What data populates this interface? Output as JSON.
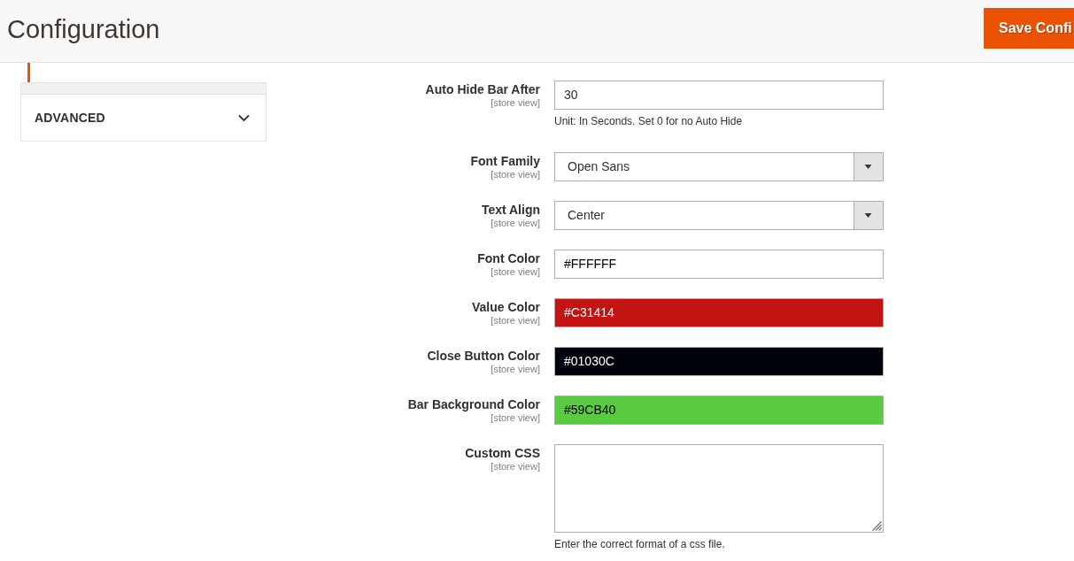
{
  "header": {
    "title": "Configuration",
    "save_button": {
      "label": "Save Confi"
    }
  },
  "sidebar": {
    "items": [
      {
        "selected": true
      }
    ],
    "sections": [
      {
        "label": "ADVANCED",
        "expanded": false
      }
    ]
  },
  "fields": [
    {
      "kind": "text",
      "label": "Auto Hide Bar After",
      "scope": "[store view]",
      "value": "30",
      "note": "Unit: In Seconds. Set 0 for no Auto Hide"
    },
    {
      "kind": "select",
      "label": "Font Family",
      "scope": "[store view]",
      "value": "Open Sans"
    },
    {
      "kind": "select",
      "label": "Text Align",
      "scope": "[store view]",
      "value": "Center"
    },
    {
      "kind": "color",
      "label": "Font Color",
      "scope": "[store view]",
      "value": "#FFFFFF",
      "color": "#ffffff"
    },
    {
      "kind": "color",
      "label": "Value Color",
      "scope": "[store view]",
      "value": "#C31414",
      "color": "#c31414"
    },
    {
      "kind": "color",
      "label": "Close Button Color",
      "scope": "[store view]",
      "value": "#01030C",
      "color": "#01030c"
    },
    {
      "kind": "color",
      "label": "Bar Background Color",
      "scope": "[store view]",
      "value": "#59CB40",
      "color": "#59cb40"
    },
    {
      "kind": "textarea",
      "label": "Custom CSS",
      "scope": "[store view]",
      "note": "Enter the correct format of a css file."
    }
  ]
}
